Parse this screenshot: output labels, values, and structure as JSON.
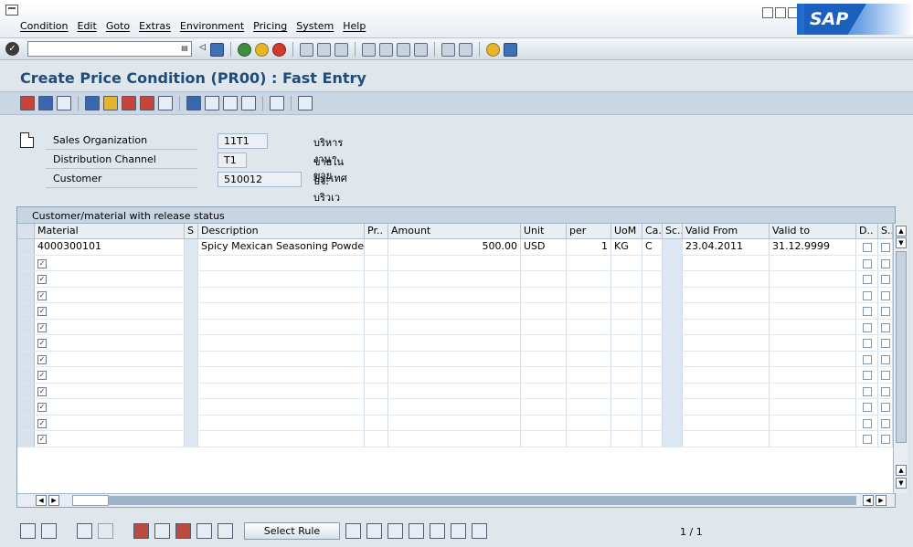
{
  "menubar": {
    "items": [
      "Condition",
      "Edit",
      "Goto",
      "Extras",
      "Environment",
      "Pricing",
      "System",
      "Help"
    ],
    "logo": "SAP"
  },
  "toolbar": {
    "command_value": ""
  },
  "title": "Create Price Condition (PR00) : Fast Entry",
  "header": {
    "fields": [
      {
        "label": "Sales Organization",
        "value": "11T1",
        "desc": "บริหารงานขาย"
      },
      {
        "label": "Distribution Channel",
        "value": "T1",
        "desc": "ขายในประเทศ"
      },
      {
        "label": "Customer",
        "value": "510012",
        "desc": "บจ. บริวเวอรี่"
      }
    ]
  },
  "table": {
    "title": "Customer/material with release status",
    "columns": [
      "Material",
      "S",
      "Description",
      "Pr..",
      "Amount",
      "Unit",
      "per",
      "UoM",
      "Ca..",
      "Sc..",
      "Valid From",
      "Valid to",
      "D..",
      "S.."
    ],
    "rows": [
      {
        "material": "4000300101",
        "s": "",
        "description": "Spicy Mexican Seasoning Powder",
        "pr": "",
        "amount": "500.00",
        "unit": "USD",
        "per": "1",
        "uom": "KG",
        "ca": "C",
        "sc": "",
        "valid_from": "23.04.2011",
        "valid_to": "31.12.9999"
      }
    ],
    "empty_rows": 12
  },
  "bottom": {
    "select_rule": "Select Rule",
    "page": "1",
    "page_sep": "/",
    "page_total": "1"
  }
}
